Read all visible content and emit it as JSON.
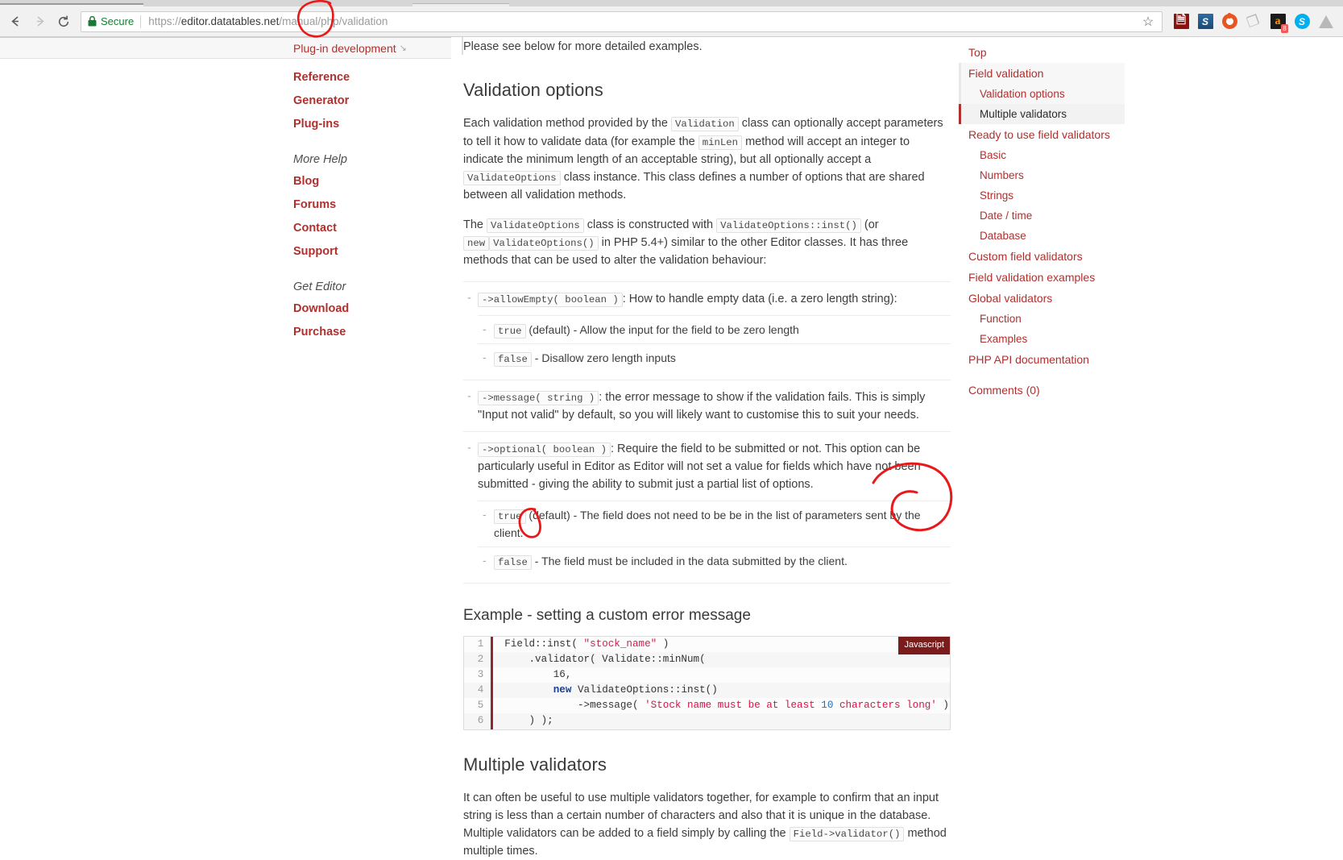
{
  "browser": {
    "back_label": "Back",
    "forward_label": "Forward",
    "reload_label": "Reload",
    "secure_label": "Secure",
    "url_prefix": "https://",
    "url_domain": "editor.datatables.net",
    "url_path": "/manual/php/validation",
    "url_full": "https://editor.datatables.net/manual/php/validation",
    "bookmark_label": "☆",
    "extensions": [
      {
        "name": "adobe-acrobat-extension",
        "glyph": "A"
      },
      {
        "name": "s-extension",
        "glyph": "S"
      },
      {
        "name": "ubuntu-extension",
        "glyph": ""
      },
      {
        "name": "broom-extension",
        "glyph": "✐"
      },
      {
        "name": "amazon-extension",
        "glyph": "a",
        "badge": "8"
      },
      {
        "name": "skype-extension",
        "glyph": "S"
      },
      {
        "name": "drive-extension",
        "glyph": ""
      }
    ]
  },
  "sidebar": {
    "highlighted": {
      "label": "Plug-in development",
      "arrow": "↘"
    },
    "links": [
      {
        "label": "Reference"
      },
      {
        "label": "Generator"
      },
      {
        "label": "Plug-ins"
      }
    ],
    "more_help_heading": "More Help",
    "more_help_links": [
      {
        "label": "Blog"
      },
      {
        "label": "Forums"
      },
      {
        "label": "Contact"
      },
      {
        "label": "Support"
      }
    ],
    "get_editor_heading": "Get Editor",
    "get_editor_links": [
      {
        "label": "Download"
      },
      {
        "label": "Purchase"
      }
    ]
  },
  "main": {
    "intro": "Please see below for more detailed examples.",
    "section_title": "Validation options",
    "para1_a": "Each validation method provided by the ",
    "para1_code1": "Validation",
    "para1_b": " class can optionally accept parameters to tell it how to validate data (for example the ",
    "para1_code2": "minLen",
    "para1_c": " method will accept an integer to indicate the minimum length of an acceptable string), but all optionally accept a ",
    "para1_code3": "ValidateOptions",
    "para1_d": " class instance. This class defines a number of options that are shared between all validation methods.",
    "para2_a": "The ",
    "para2_code1": "ValidateOptions",
    "para2_b": " class is constructed with ",
    "para2_code2": "ValidateOptions::inst()",
    "para2_c": " (or ",
    "para2_code3": "new",
    "para2_code4": "ValidateOptions()",
    "para2_d": " in PHP 5.4+) similar to the other Editor classes. It has three methods that can be used to alter the validation behaviour:",
    "options": [
      {
        "code": "->allowEmpty( boolean )",
        "text": ": How to handle empty data (i.e. a zero length string):",
        "sub": [
          {
            "code": "true",
            "text": "(default) - Allow the input for the field to be zero length"
          },
          {
            "code": "false",
            "text": "- Disallow zero length inputs"
          }
        ]
      },
      {
        "code": "->message( string )",
        "text": ": the error message to show if the validation fails. This is simply \"Input not valid\" by default, so you will likely want to customise this to suit your needs.",
        "sub": []
      },
      {
        "code": "->optional( boolean )",
        "text": ": Require the field to be submitted or not. This option can be particularly useful in Editor as Editor will not set a value for fields which have not been submitted - giving the ability to submit just a partial list of options.",
        "sub": [
          {
            "code": "true",
            "text": "(default) - The field does not need to be be in the list of parameters sent by the client."
          },
          {
            "code": "false",
            "text": "- The field must be included in the data submitted by the client."
          }
        ]
      }
    ],
    "example_title": "Example - setting a custom error message",
    "code_language": "Javascript",
    "code_lines": [
      {
        "n": "1",
        "text": "Field::inst( \"stock_name\" )"
      },
      {
        "n": "2",
        "text": "    .validator( Validate::minNum("
      },
      {
        "n": "3",
        "text": "        16,"
      },
      {
        "n": "4",
        "text": "        new ValidateOptions::inst()"
      },
      {
        "n": "5",
        "text": "            ->message( 'Stock name must be at least 10 characters long' )"
      },
      {
        "n": "6",
        "text": "    ) );"
      }
    ],
    "multiple_title": "Multiple validators",
    "multiple_para_a": "It can often be useful to use multiple validators together, for example to confirm that an input string is less than a certain number of characters and also that it is unique in the database. Multiple validators can be added to a field simply by calling the ",
    "multiple_code": "Field->validator()",
    "multiple_para_b": " method multiple times."
  },
  "toc": {
    "items": [
      {
        "label": "Top",
        "level": 1,
        "state": "normal"
      },
      {
        "label": "Field validation",
        "level": 1,
        "state": "active-parent"
      },
      {
        "label": "Validation options",
        "level": 2,
        "state": "parent-child"
      },
      {
        "label": "Multiple validators",
        "level": 2,
        "state": "active"
      },
      {
        "label": "Ready to use field validators",
        "level": 1,
        "state": "normal"
      },
      {
        "label": "Basic",
        "level": 2,
        "state": "normal"
      },
      {
        "label": "Numbers",
        "level": 2,
        "state": "normal"
      },
      {
        "label": "Strings",
        "level": 2,
        "state": "normal"
      },
      {
        "label": "Date / time",
        "level": 2,
        "state": "normal"
      },
      {
        "label": "Database",
        "level": 2,
        "state": "normal"
      },
      {
        "label": "Custom field validators",
        "level": 1,
        "state": "normal"
      },
      {
        "label": "Field validation examples",
        "level": 1,
        "state": "normal"
      },
      {
        "label": "Global validators",
        "level": 1,
        "state": "normal"
      },
      {
        "label": "Function",
        "level": 2,
        "state": "normal"
      },
      {
        "label": "Examples",
        "level": 2,
        "state": "normal"
      },
      {
        "label": "PHP API documentation",
        "level": 1,
        "state": "normal"
      },
      {
        "label": "Comments (0)",
        "level": 1,
        "state": "normal"
      }
    ]
  },
  "annotations": {
    "color": "#e8191b",
    "marks": [
      {
        "name": "url-php-circle",
        "about": "circle around /php/ in the address bar"
      },
      {
        "name": "code-dot-circle",
        "about": "circle around the leading dot of .validator"
      },
      {
        "name": "javascript-badge-circle",
        "about": "circle around the Javascript language badge"
      }
    ]
  }
}
